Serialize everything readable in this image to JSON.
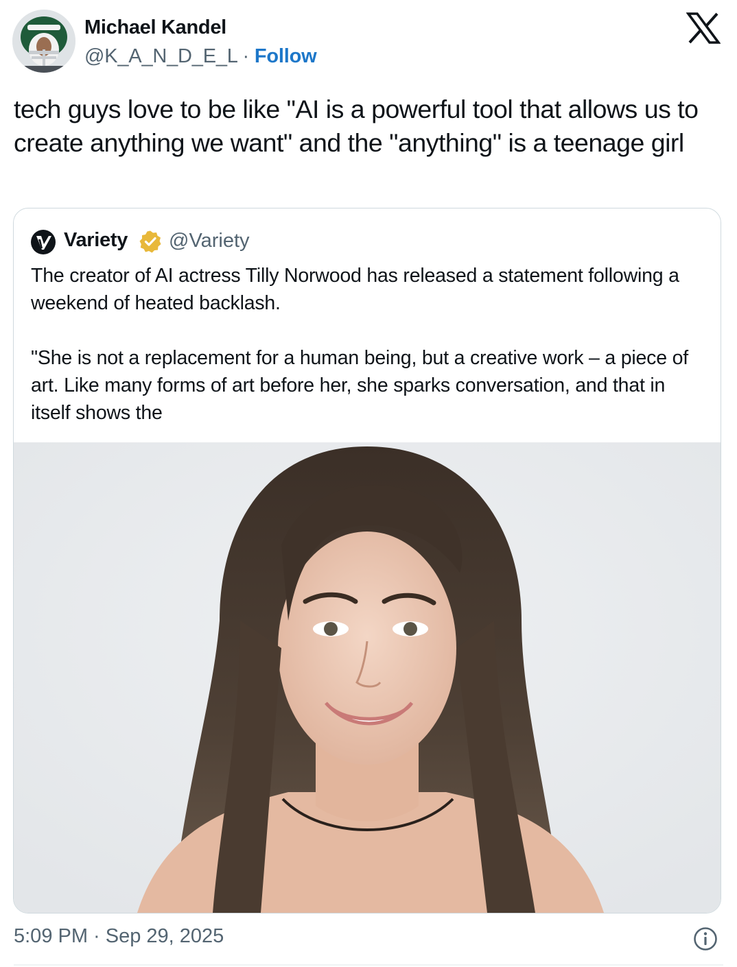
{
  "author": {
    "name": "Michael Kandel",
    "handle": "@K_A_N_D_E_L",
    "separator": "·",
    "follow_label": "Follow"
  },
  "tweet": {
    "text": "tech guys love to be like \"AI is a powerful tool that allows us to create anything we want\" and the \"anything\" is a teenage girl"
  },
  "quoted_tweet": {
    "name": "Variety",
    "handle": "@Variety",
    "verified": true,
    "paragraph_1": "The creator of AI actress Tilly Norwood has released a statement following a weekend of heated backlash.",
    "paragraph_2": "\"She is not a replacement for a human being, but a creative work – a piece of art. Like many forms of art before her, she sparks conversation, and that in itself shows the"
  },
  "footer": {
    "timestamp": "5:09 PM · Sep 29, 2025"
  },
  "icons": {
    "brand": "x-logo-icon",
    "info": "info-icon",
    "verified": "verified-badge-icon"
  },
  "colors": {
    "text": "#0f1419",
    "secondary": "#536471",
    "link": "#1d77c9",
    "border": "#cfd9de",
    "badge": "#e8b83a"
  }
}
